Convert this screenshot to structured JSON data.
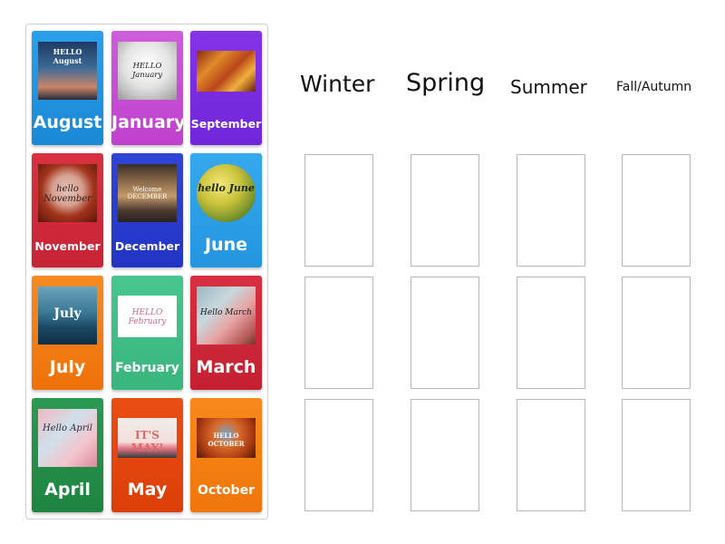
{
  "headers": [
    "Winter",
    "Spring",
    "Summer",
    "Fall/Autumn"
  ],
  "cards": [
    {
      "label": "August",
      "color": "#1e94e0",
      "image_text": "HELLO August"
    },
    {
      "label": "January",
      "color": "#c54ad3",
      "image_text": "HELLO January"
    },
    {
      "label": "September",
      "color": "#7a2be0",
      "image_text": ""
    },
    {
      "label": "November",
      "color": "#d42b3c",
      "image_text": "hello November"
    },
    {
      "label": "December",
      "color": "#2a3fcf",
      "image_text": "Welcome DECEMBER"
    },
    {
      "label": "June",
      "color": "#2ea0e8",
      "image_text": "hello June"
    },
    {
      "label": "July",
      "color": "#f47e14",
      "image_text": "July"
    },
    {
      "label": "February",
      "color": "#3fbf88",
      "image_text": "HELLO February"
    },
    {
      "label": "March",
      "color": "#d22a3a",
      "image_text": "Hello March"
    },
    {
      "label": "April",
      "color": "#249048",
      "image_text": "Hello April"
    },
    {
      "label": "May",
      "color": "#e5440f",
      "image_text": "IT'S MAY!"
    },
    {
      "label": "October",
      "color": "#f57d12",
      "image_text": "HELLO OCTOBER"
    }
  ],
  "slots_per_column": 3
}
